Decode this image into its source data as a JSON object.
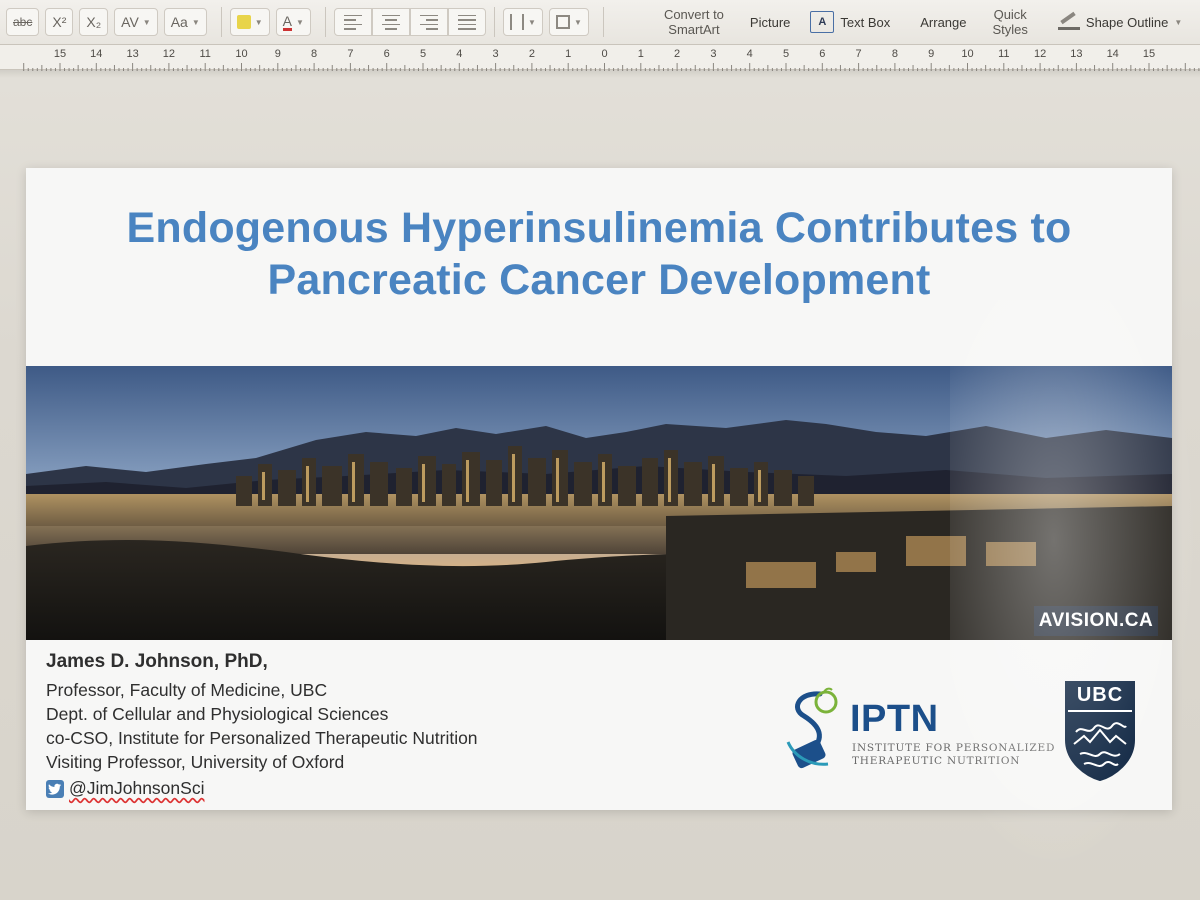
{
  "toolbar": {
    "strikethrough": "abc",
    "superscript": "X²",
    "subscript": "X₂",
    "character_spacing": "AV",
    "change_case": "Aa",
    "font_color": "A",
    "convert_smartart_line1": "Convert to",
    "convert_smartart_line2": "SmartArt",
    "picture": "Picture",
    "text_box_icon": "A",
    "text_box": "Text Box",
    "arrange": "Arrange",
    "quick_styles_line1": "Quick",
    "quick_styles_line2": "Styles",
    "shape_outline": "Shape Outline"
  },
  "ruler": {
    "labels": [
      "15",
      "14",
      "13",
      "12",
      "11",
      "10",
      "9",
      "8",
      "7",
      "6",
      "5",
      "4",
      "3",
      "2",
      "1",
      "0",
      "1",
      "2",
      "3",
      "4",
      "5",
      "6",
      "7",
      "8",
      "9",
      "10",
      "11",
      "12",
      "13",
      "14",
      "15"
    ]
  },
  "slide": {
    "title_line1": "Endogenous Hyperinsulinemia Contributes to",
    "title_line2": "Pancreatic Cancer Development",
    "photo_credit": "AVISION.CA",
    "author_name": "James D. Johnson, PhD,",
    "author_lines": [
      "Professor, Faculty of Medicine, UBC",
      "Dept. of Cellular and Physiological Sciences",
      "co-CSO, Institute for Personalized Therapeutic Nutrition",
      "Visiting Professor, University of Oxford"
    ],
    "twitter_handle": "@JimJohnsonSci",
    "iptn": {
      "acronym": "IPTN",
      "sub_line1": "INSTITUTE FOR PERSONALIZED",
      "sub_line2": "THERAPEUTIC NUTRITION"
    },
    "ubc_logo_text": "UBC"
  },
  "colors": {
    "title_blue": "#4a84c1",
    "iptn_blue": "#1c4f8a",
    "ubc_navy": "#0c2340",
    "slide_bg": "#f7f7f6"
  }
}
